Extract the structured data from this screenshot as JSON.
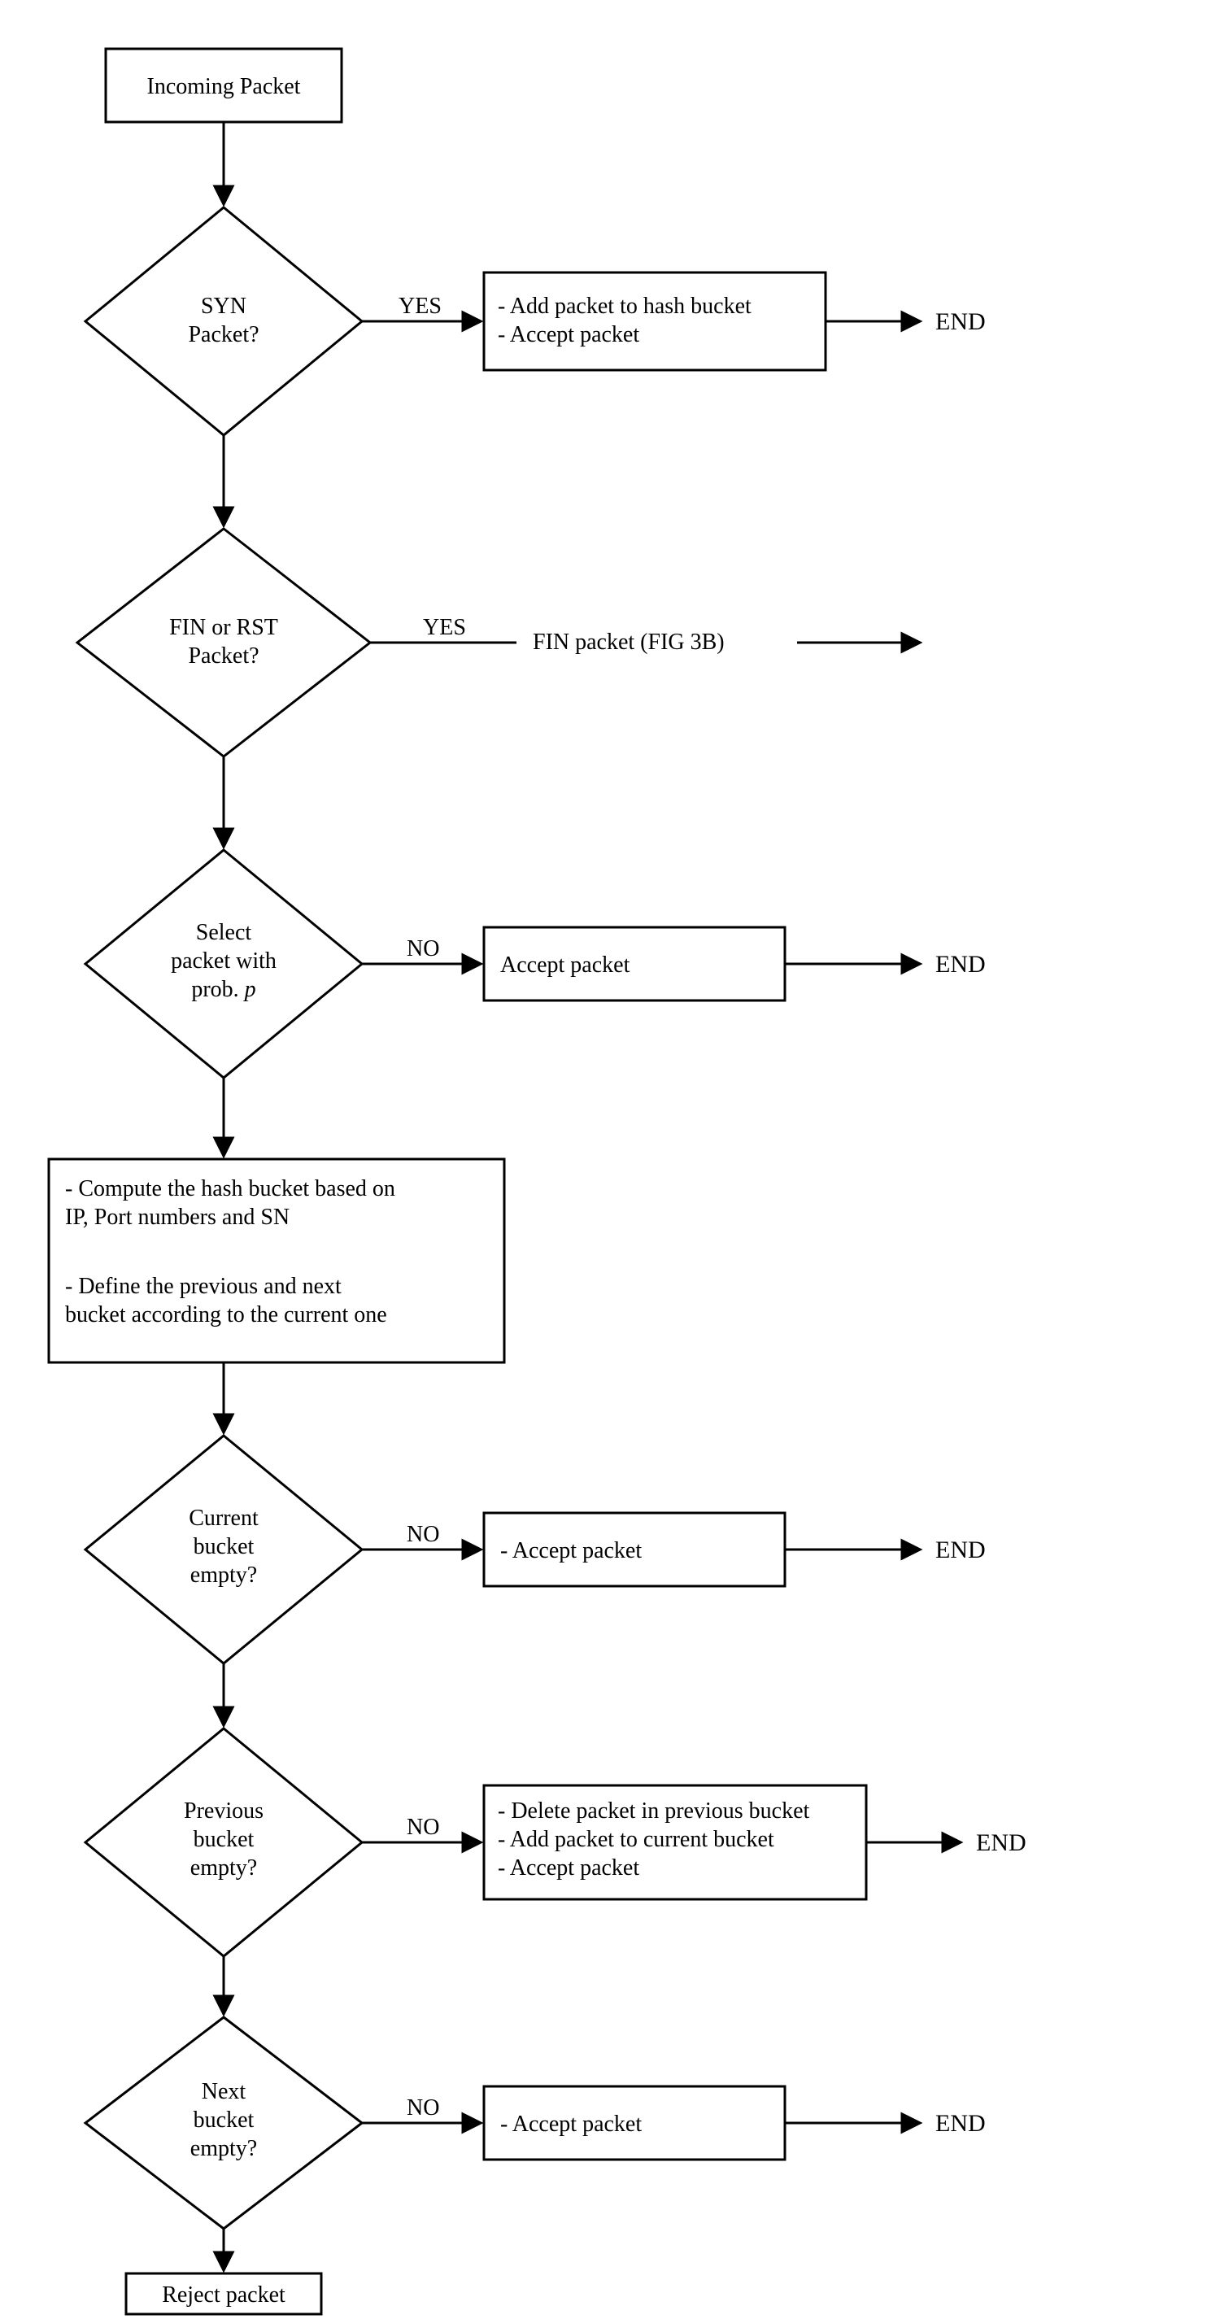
{
  "start": "Incoming Packet",
  "d1": {
    "l1": "SYN",
    "l2": "Packet?"
  },
  "d1_yes": "YES",
  "p1_l1": "- Add packet to hash bucket",
  "p1_l2": "- Accept packet",
  "end1": "END",
  "d2": {
    "l1": "FIN or RST",
    "l2": "Packet?"
  },
  "d2_yes": "YES",
  "fin_ref": "FIN packet (FIG 3B)",
  "d3": {
    "l1": "Select",
    "l2": "packet with",
    "l3a": "prob. ",
    "l3b": "p"
  },
  "d3_no": "NO",
  "p3": "Accept packet",
  "end3": "END",
  "proc_l1": "- Compute the hash bucket based on",
  "proc_l2": "IP, Port numbers and SN",
  "proc_l3": "- Define the previous and next",
  "proc_l4": "bucket according to the current one",
  "d4": {
    "l1": "Current",
    "l2": "bucket",
    "l3": "empty?"
  },
  "d4_no": "NO",
  "p4": "- Accept packet",
  "end4": "END",
  "d5": {
    "l1": "Previous",
    "l2": "bucket",
    "l3": "empty?"
  },
  "d5_no": "NO",
  "p5_l1": "- Delete packet in previous bucket",
  "p5_l2": "- Add packet to current bucket",
  "p5_l3": "- Accept packet",
  "end5": "END",
  "d6": {
    "l1": "Next",
    "l2": "bucket",
    "l3": "empty?"
  },
  "d6_no": "NO",
  "p6": "- Accept packet",
  "end6": "END",
  "reject": "Reject packet"
}
